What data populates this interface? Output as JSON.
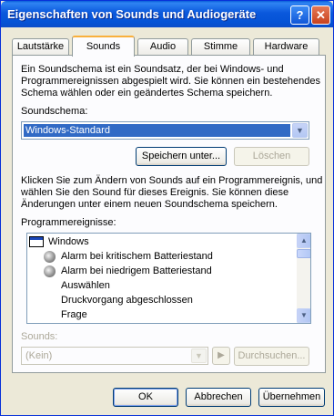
{
  "window": {
    "title": "Eigenschaften von Sounds und Audiogeräte",
    "help_label": "?",
    "close_label": "✕"
  },
  "tabs": [
    {
      "label": "Lautstärke"
    },
    {
      "label": "Sounds",
      "active": true
    },
    {
      "label": "Audio"
    },
    {
      "label": "Stimme"
    },
    {
      "label": "Hardware"
    }
  ],
  "sounds": {
    "intro_line1": "Ein Soundschema ist ein Soundsatz, der bei Windows- und",
    "intro_line2": "Programmereignissen abgespielt wird. Sie können ein bestehendes",
    "intro_line3": "Schema wählen oder ein geändertes Schema speichern.",
    "scheme_label": "Soundschema:",
    "scheme_value": "Windows-Standard",
    "save_as_label": "Speichern unter...",
    "delete_label": "Löschen",
    "instructions_line1": "Klicken Sie zum Ändern von Sounds auf ein Programmereignis, und",
    "instructions_line2": "wählen Sie den Sound für dieses Ereignis. Sie können diese",
    "instructions_line3": "Änderungen unter einem neuen Soundschema speichern.",
    "events_label": "Programmereignisse:",
    "events": [
      {
        "label": "Windows",
        "icon": "window-icon"
      },
      {
        "label": "Alarm bei kritischem Batteriestand",
        "icon": "speaker-icon"
      },
      {
        "label": "Alarm bei niedrigem Batteriestand",
        "icon": "speaker-icon"
      },
      {
        "label": "Auswählen",
        "icon": ""
      },
      {
        "label": "Druckvorgang abgeschlossen",
        "icon": ""
      },
      {
        "label": "Frage",
        "icon": ""
      }
    ],
    "sounds_label": "Sounds:",
    "sound_value": "(Kein)",
    "play_label": "▶",
    "browse_label": "Durchsuchen..."
  },
  "footer": {
    "ok_label": "OK",
    "cancel_label": "Abbrechen",
    "apply_label": "Übernehmen"
  },
  "colors": {
    "titlebar": "#0a58dc",
    "selection": "#316ac5",
    "active_tab_accent": "#f9b03c"
  }
}
